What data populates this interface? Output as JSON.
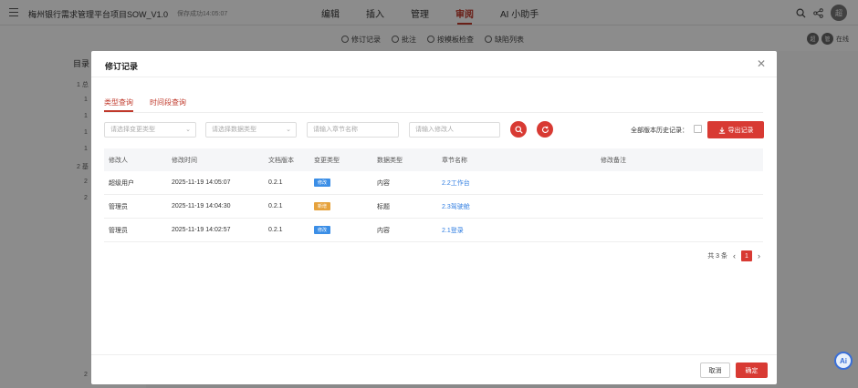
{
  "topbar": {
    "doc_title": "梅州银行需求管理平台项目SOW_V1.0",
    "save_status": "保存成功14:05:07",
    "tabs": [
      {
        "label": "编辑",
        "active": false
      },
      {
        "label": "插入",
        "active": false
      },
      {
        "label": "管理",
        "active": false
      },
      {
        "label": "审阅",
        "active": true
      },
      {
        "label": "AI 小助手",
        "active": false
      }
    ],
    "avatar_text": "超"
  },
  "subbar": {
    "tools": [
      "修订记录",
      "批注",
      "按模板检查",
      "缺陷列表"
    ],
    "right_text": "在线",
    "right_avatars": [
      "超",
      "管"
    ]
  },
  "toc": {
    "title": "目录",
    "lines": [
      "1 总",
      "1",
      "1",
      "1",
      "1",
      "2 基",
      "2",
      "2",
      "2"
    ]
  },
  "modal": {
    "title": "修订记录",
    "tabs": [
      {
        "label": "类型查询",
        "active": true
      },
      {
        "label": "时间段查询",
        "active": false
      }
    ],
    "filters": {
      "change_type_placeholder": "请选择变更类型",
      "data_type_placeholder": "请选择数据类型",
      "section_placeholder": "请输入章节名称",
      "modifier_placeholder": "请输入修改人"
    },
    "history_label": "全部版本历史记录：",
    "export_label": "导出记录",
    "columns": [
      "修改人",
      "修改时间",
      "文档版本",
      "变更类型",
      "数据类型",
      "章节名称",
      "修改备注"
    ],
    "rows": [
      {
        "user": "超级用户",
        "time": "2025-11-19 14:05:07",
        "version": "0.2.1",
        "change": "修改",
        "change_color": "#3b8ee6",
        "data_type": "内容",
        "section": "2.2工作台",
        "note": ""
      },
      {
        "user": "管理员",
        "time": "2025-11-19 14:04:30",
        "version": "0.2.1",
        "change": "新增",
        "change_color": "#e6a23c",
        "data_type": "标题",
        "section": "2.3驾驶舱",
        "note": ""
      },
      {
        "user": "管理员",
        "time": "2025-11-19 14:02:57",
        "version": "0.2.1",
        "change": "修改",
        "change_color": "#3b8ee6",
        "data_type": "内容",
        "section": "2.1登录",
        "note": ""
      }
    ],
    "pagination": {
      "total": "共 3 条",
      "current_page": "1"
    },
    "cancel_label": "取消",
    "ok_label": "确定"
  },
  "ai_fab": "Ai",
  "colors": {
    "accent": "#d83a33",
    "link": "#2f7de1"
  }
}
